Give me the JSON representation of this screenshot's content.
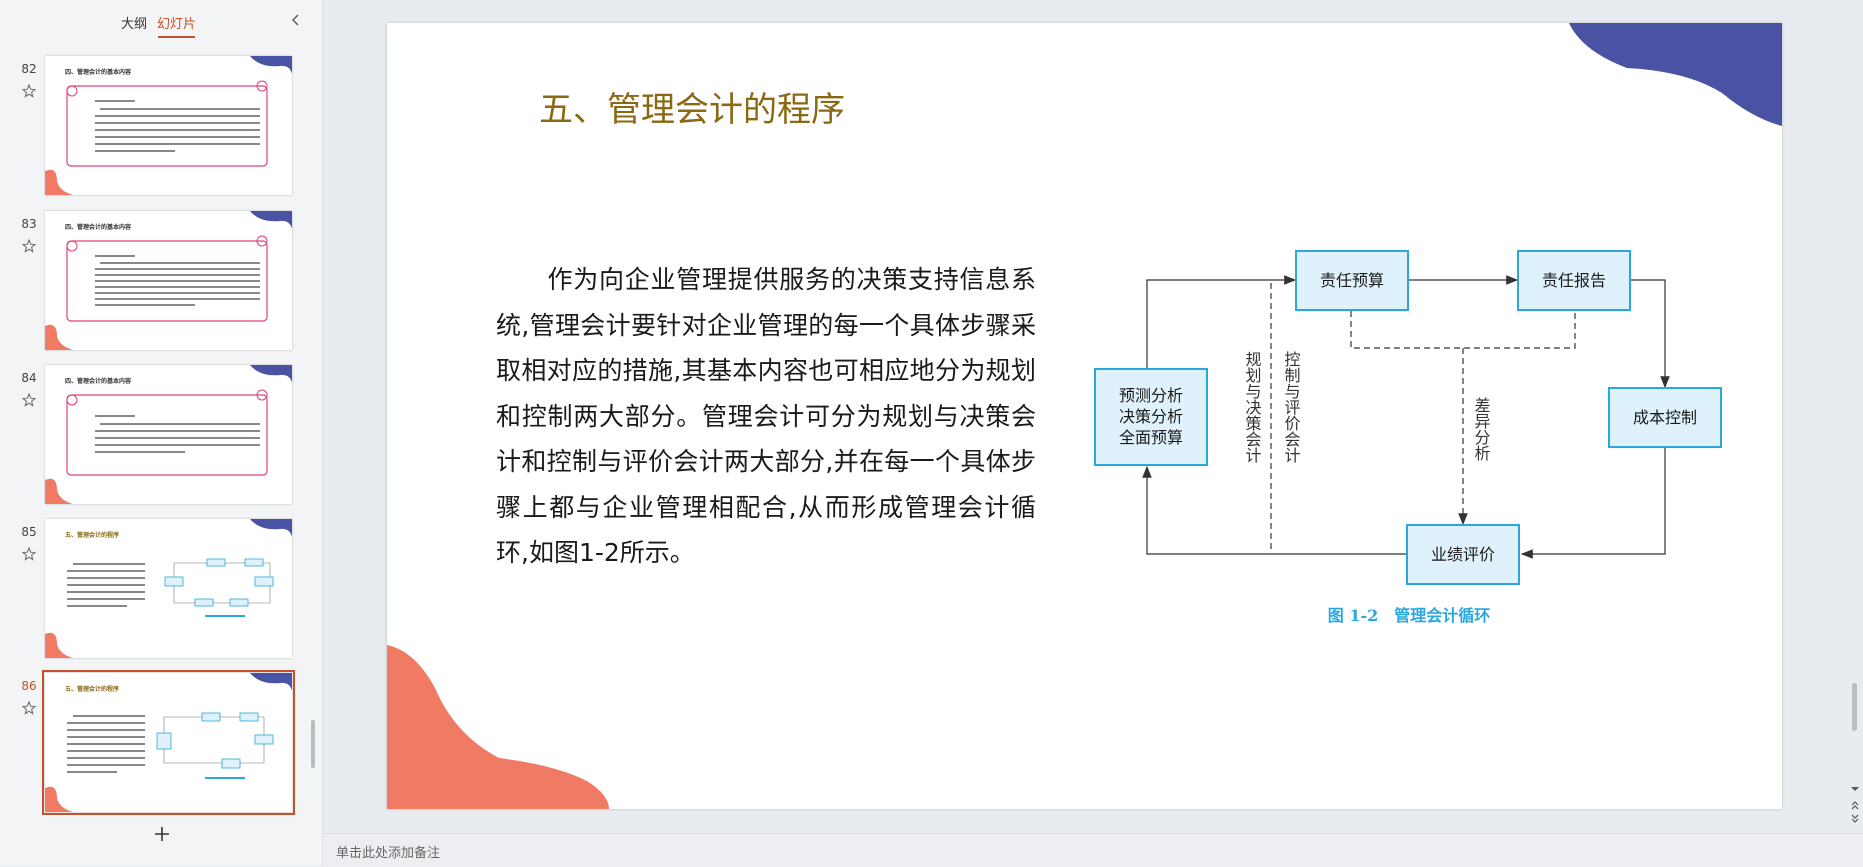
{
  "panel": {
    "tabs": [
      "大纲",
      "幻灯片"
    ],
    "active_tab": "幻灯片"
  },
  "slides": [
    {
      "number": "82",
      "title": "四、管理会计的基本内容"
    },
    {
      "number": "83",
      "title": "四、管理会计的基本内容"
    },
    {
      "number": "84",
      "title": "四、管理会计的基本内容"
    },
    {
      "number": "85",
      "title": "五、管理会计的程序"
    },
    {
      "number": "86",
      "title": "五、管理会计的程序",
      "selected": true
    }
  ],
  "slide": {
    "title": "五、管理会计的程序",
    "body": "　　作为向企业管理提供服务的决策支持信息系统,管理会计要针对企业管理的每一个具体步骤采取相对应的措施,其基本内容也可相应地分为规划和控制两大部分。管理会计可分为规划与决策会计和控制与评价会计两大部分,并在每一个具体步骤上都与企业管理相配合,从而形成管理会计循环,如图1-2所示。",
    "diagram": {
      "boxes": {
        "forecast": [
          "预测分析",
          "决策分析",
          "全面预算"
        ],
        "budget": "责任预算",
        "report": "责任报告",
        "cost": "成本控制",
        "evaluation": "业绩评价"
      },
      "vertical_labels": {
        "planning": "规划与决策会计",
        "control": "控制与评价会计",
        "variance": "差异分析"
      },
      "caption": "图 1-2　管理会计循环"
    }
  },
  "notes": {
    "placeholder": "单击此处添加备注"
  },
  "colors": {
    "accent": "#c5502a",
    "title_gold": "#8b6914",
    "blob_coral": "#f07a64",
    "blob_blue": "#4a52a3",
    "box_fill": "#dff1fa",
    "box_border": "#29a8dd",
    "caption_blue": "#29a8dd"
  }
}
